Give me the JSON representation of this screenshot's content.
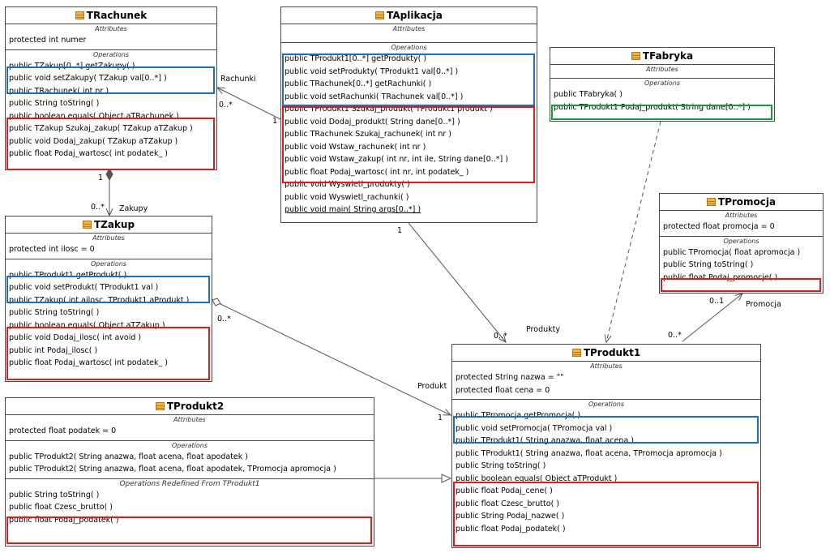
{
  "sections": {
    "attributes": "Attributes",
    "operations": "Operations"
  },
  "classes": {
    "rachunek": {
      "name": "TRachunek",
      "attributes": [
        "protected int numer"
      ],
      "operations": [
        "public TZakup[0..*]  getZakupy(  )",
        "public void  setZakupy( TZakup val[0..*] )",
        "public TRachunek( int nr )",
        "public String  toString(  )",
        "public boolean  equals( Object aTRachunek )",
        "public TZakup  Szukaj_zakup( TZakup aTZakup )",
        "public void  Dodaj_zakup( TZakup aTZakup )",
        "public float  Podaj_wartosc( int podatek_ )"
      ]
    },
    "aplikacja": {
      "name": "TAplikacja",
      "operations": [
        "public TProdukt1[0..*]  getProdukty(  )",
        "public void  setProdukty( TProdukt1 val[0..*] )",
        "public TRachunek[0..*]  getRachunki(  )",
        "public void  setRachunki( TRachunek val[0..*] )",
        "public TProdukt1  Szukaj_produkt( TProdukt1 produkt )",
        "public void  Dodaj_produkt( String dane[0..*] )",
        "public TRachunek  Szukaj_rachunek( int nr )",
        "public void  Wstaw_rachunek( int nr )",
        "public void  Wstaw_zakup( int nr, int ile, String dane[0..*] )",
        "public float  Podaj_wartosc( int nr, int podatek_ )",
        "public void  Wyswietl_produkty(  )",
        "public void  Wyswietl_rachunki(  )",
        "public void  main( String args[0..*] )"
      ]
    },
    "fabryka": {
      "name": "TFabryka",
      "operations": [
        "public TFabryka(  )",
        "public TProdukt1  Podaj_produkt( String dane[0..*] )"
      ]
    },
    "promocja": {
      "name": "TPromocja",
      "attributes": [
        "protected float promocja = 0"
      ],
      "operations": [
        "public TPromocja( float apromocja )",
        "public String  toString(  )",
        "public float  Podaj_promocje(  )"
      ]
    },
    "zakup": {
      "name": "TZakup",
      "attributes": [
        "protected int ilosc = 0"
      ],
      "operations": [
        "public TProdukt1  getProdukt(  )",
        "public void  setProdukt( TProdukt1 val )",
        "public TZakup( int ailosc, TProdukt1 aProdukt )",
        "public String  toString(  )",
        "public boolean  equals( Object aTZakup )",
        "public void  Dodaj_ilosc( int avoid )",
        "public int  Podaj_ilosc(  )",
        "public float  Podaj_wartosc( int podatek_ )"
      ]
    },
    "produkt2": {
      "name": "TProdukt2",
      "attributes": [
        "protected float podatek = 0"
      ],
      "operations": [
        "public TProdukt2( String anazwa, float acena, float apodatek )",
        "public TProdukt2( String anazwa, float acena, float apodatek, TPromocja apromocja )"
      ],
      "redefined_title": "Operations Redefined From TProdukt1",
      "redefined": [
        "public String  toString(  )",
        "public float  Czesc_brutto(  )",
        "public float  Podaj_podatek(  )"
      ]
    },
    "produkt1": {
      "name": "TProdukt1",
      "attributes": [
        "protected String nazwa = \"\"",
        "protected float cena = 0"
      ],
      "operations": [
        "public TPromocja  getPromocja(  )",
        "public void  setPromocja( TPromocja val )",
        "public TProdukt1( String anazwa, float acena )",
        "public TProdukt1( String anazwa, float acena, TPromocja apromocja )",
        "public String  toString(  )",
        "public boolean  equals( Object aTProdukt )",
        "public float  Podaj_cene(  )",
        "public float  Czesc_brutto(  )",
        "public String  Podaj_nazwe(  )",
        "public float  Podaj_podatek(  )"
      ]
    }
  },
  "associations": {
    "rachunki": {
      "name": "Rachunki",
      "mult_near": "0..*",
      "mult_far": "1"
    },
    "zakupy": {
      "name": "Zakupy",
      "mult_near": "1",
      "mult_far": "0..*"
    },
    "produkty": {
      "name": "Produkty",
      "mult_near": "1",
      "mult_far": "0..*"
    },
    "produkt": {
      "name": "Produkt",
      "mult_near": "0..*",
      "mult_far": "1"
    },
    "promocja": {
      "name": "Promocja",
      "mult_near": "0..1",
      "mult_far": "0..*"
    }
  },
  "colors": {
    "interface_group": "#1f6fb8",
    "method_group": "#e01b1b",
    "factory_group": "#1a9a3a",
    "class_icon": "#f2b24a"
  }
}
